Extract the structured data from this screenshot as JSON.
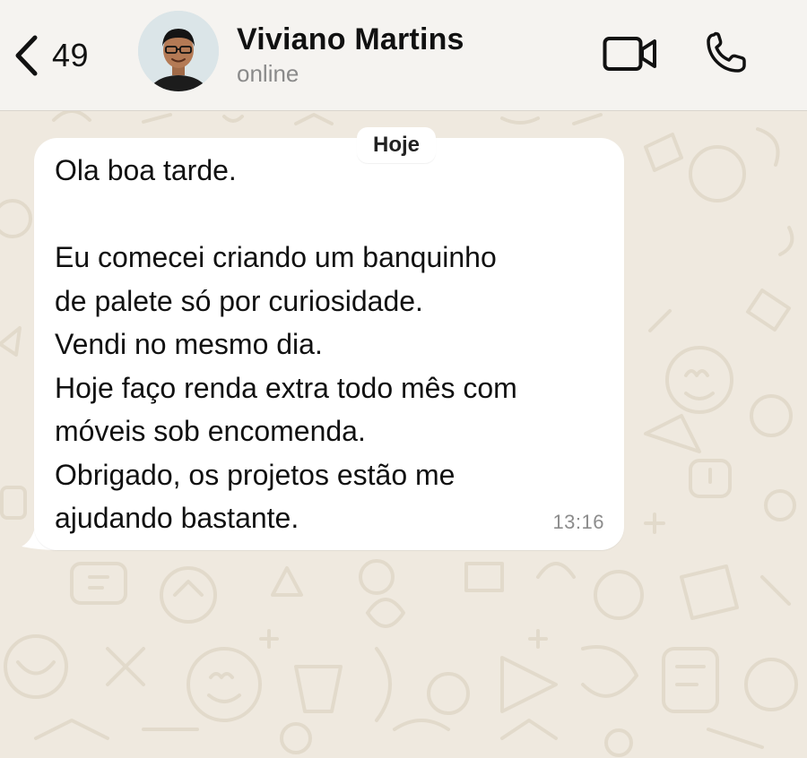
{
  "header": {
    "unread_count": "49",
    "contact_name": "Viviano Martins",
    "contact_status": "online",
    "icons": {
      "back": "chevron-left-icon",
      "video": "video-camera-icon",
      "call": "phone-icon"
    }
  },
  "chat": {
    "date_label": "Hoje",
    "messages": [
      {
        "direction": "incoming",
        "text": "Ola boa tarde.\n\nEu comecei criando um banquinho\nde palete só por curiosidade.\nVendi no mesmo dia.\nHoje faço renda extra todo mês com\nmóveis sob encomenda.\nObrigado, os projetos estão me\najudando bastante.",
        "time": "13:16"
      }
    ]
  },
  "colors": {
    "header_bg": "#f5f3f0",
    "chat_bg": "#efe9df",
    "bubble_bg": "#ffffff",
    "doodle": "#e2dacb",
    "timestamp": "#8c8c8c",
    "status": "#8a8a8a"
  }
}
